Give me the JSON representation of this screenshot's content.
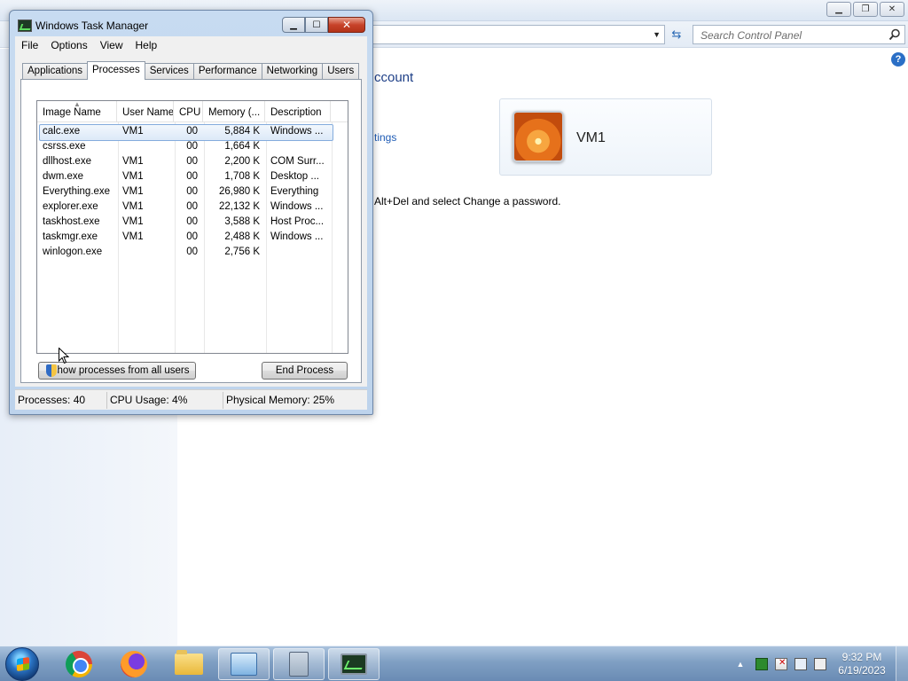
{
  "control_panel": {
    "search_placeholder": "Search Control Panel",
    "heading": "ccount",
    "link_text": "tings",
    "info_text": "Alt+Del and select Change a password.",
    "user_name": "VM1",
    "help_label": "?"
  },
  "task_manager": {
    "title": "Windows Task Manager",
    "menus": [
      "File",
      "Options",
      "View",
      "Help"
    ],
    "tabs": [
      "Applications",
      "Processes",
      "Services",
      "Performance",
      "Networking",
      "Users"
    ],
    "active_tab": "Processes",
    "columns": [
      "Image Name",
      "User Name",
      "CPU",
      "Memory (...",
      "Description"
    ],
    "processes": [
      {
        "image": "calc.exe",
        "user": "VM1",
        "cpu": "00",
        "memory": "5,884 K",
        "description": "Windows ...",
        "selected": true
      },
      {
        "image": "csrss.exe",
        "user": "",
        "cpu": "00",
        "memory": "1,664 K",
        "description": ""
      },
      {
        "image": "dllhost.exe",
        "user": "VM1",
        "cpu": "00",
        "memory": "2,200 K",
        "description": "COM Surr..."
      },
      {
        "image": "dwm.exe",
        "user": "VM1",
        "cpu": "00",
        "memory": "1,708 K",
        "description": "Desktop ..."
      },
      {
        "image": "Everything.exe",
        "user": "VM1",
        "cpu": "00",
        "memory": "26,980 K",
        "description": "Everything"
      },
      {
        "image": "explorer.exe",
        "user": "VM1",
        "cpu": "00",
        "memory": "22,132 K",
        "description": "Windows ..."
      },
      {
        "image": "taskhost.exe",
        "user": "VM1",
        "cpu": "00",
        "memory": "3,588 K",
        "description": "Host Proc..."
      },
      {
        "image": "taskmgr.exe",
        "user": "VM1",
        "cpu": "00",
        "memory": "2,488 K",
        "description": "Windows ..."
      },
      {
        "image": "winlogon.exe",
        "user": "",
        "cpu": "00",
        "memory": "2,756 K",
        "description": ""
      }
    ],
    "show_all_button": "Show processes from all users",
    "show_all_button_visible": "how processes from all users",
    "end_process_button": "End Process",
    "status": {
      "processes": "Processes: 40",
      "cpu_usage": "CPU Usage: 4%",
      "physical_memory": "Physical Memory: 25%"
    }
  },
  "taskbar": {
    "pinned": [
      "chrome-icon",
      "firefox-icon",
      "folder-icon",
      "control-panel-icon",
      "calculator-icon",
      "task-manager-icon"
    ],
    "clock_time": "9:32 PM",
    "clock_date": "6/19/2023"
  }
}
